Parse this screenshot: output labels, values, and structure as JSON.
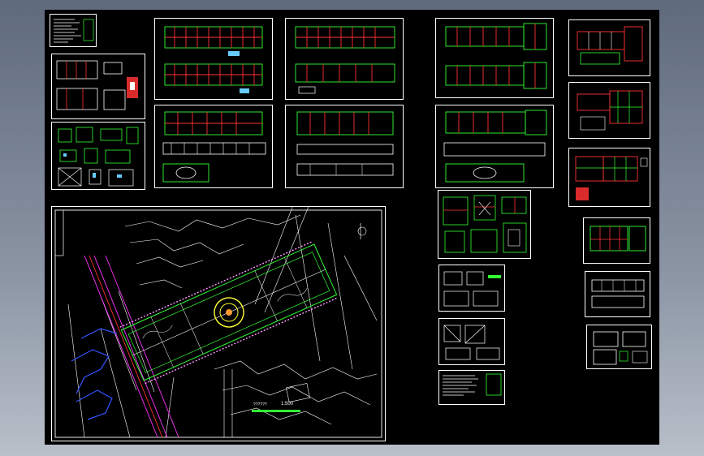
{
  "app": {
    "title": ""
  },
  "colors": {
    "desktop_top": "#5f6a7c",
    "canvas": "#000000",
    "frame": "#ffffff",
    "wall": "#ff3333",
    "grid": "#33ff33",
    "dim": "#66ccff",
    "accent": "#ffff33",
    "road": "#ff33ff",
    "river": "#3355ff"
  },
  "site_plan": {
    "scale_text": "1:500",
    "title_text": "??????"
  },
  "sheets": [
    {
      "id": "notes",
      "kind": "notes-icon"
    },
    {
      "id": "plan-a",
      "kind": "floor-plan-icon"
    },
    {
      "id": "detail-a",
      "kind": "detail-icon"
    },
    {
      "id": "plan-b",
      "kind": "floor-plan-icon"
    },
    {
      "id": "plan-c",
      "kind": "floor-plan-icon"
    },
    {
      "id": "elev-a",
      "kind": "elevation-icon"
    },
    {
      "id": "elev-b",
      "kind": "elevation-icon"
    },
    {
      "id": "plan-d",
      "kind": "floor-plan-icon"
    },
    {
      "id": "elev-c",
      "kind": "elevation-icon"
    },
    {
      "id": "plan-e",
      "kind": "floor-plan-icon"
    },
    {
      "id": "plan-f",
      "kind": "floor-plan-icon"
    },
    {
      "id": "plan-g",
      "kind": "floor-plan-icon"
    },
    {
      "id": "detail-b",
      "kind": "detail-icon"
    },
    {
      "id": "detail-c",
      "kind": "detail-icon"
    },
    {
      "id": "detail-d",
      "kind": "detail-icon"
    },
    {
      "id": "notes-b",
      "kind": "notes-icon"
    },
    {
      "id": "plan-h",
      "kind": "floor-plan-icon"
    },
    {
      "id": "elev-d",
      "kind": "elevation-icon"
    },
    {
      "id": "elev-e",
      "kind": "elevation-icon"
    }
  ]
}
